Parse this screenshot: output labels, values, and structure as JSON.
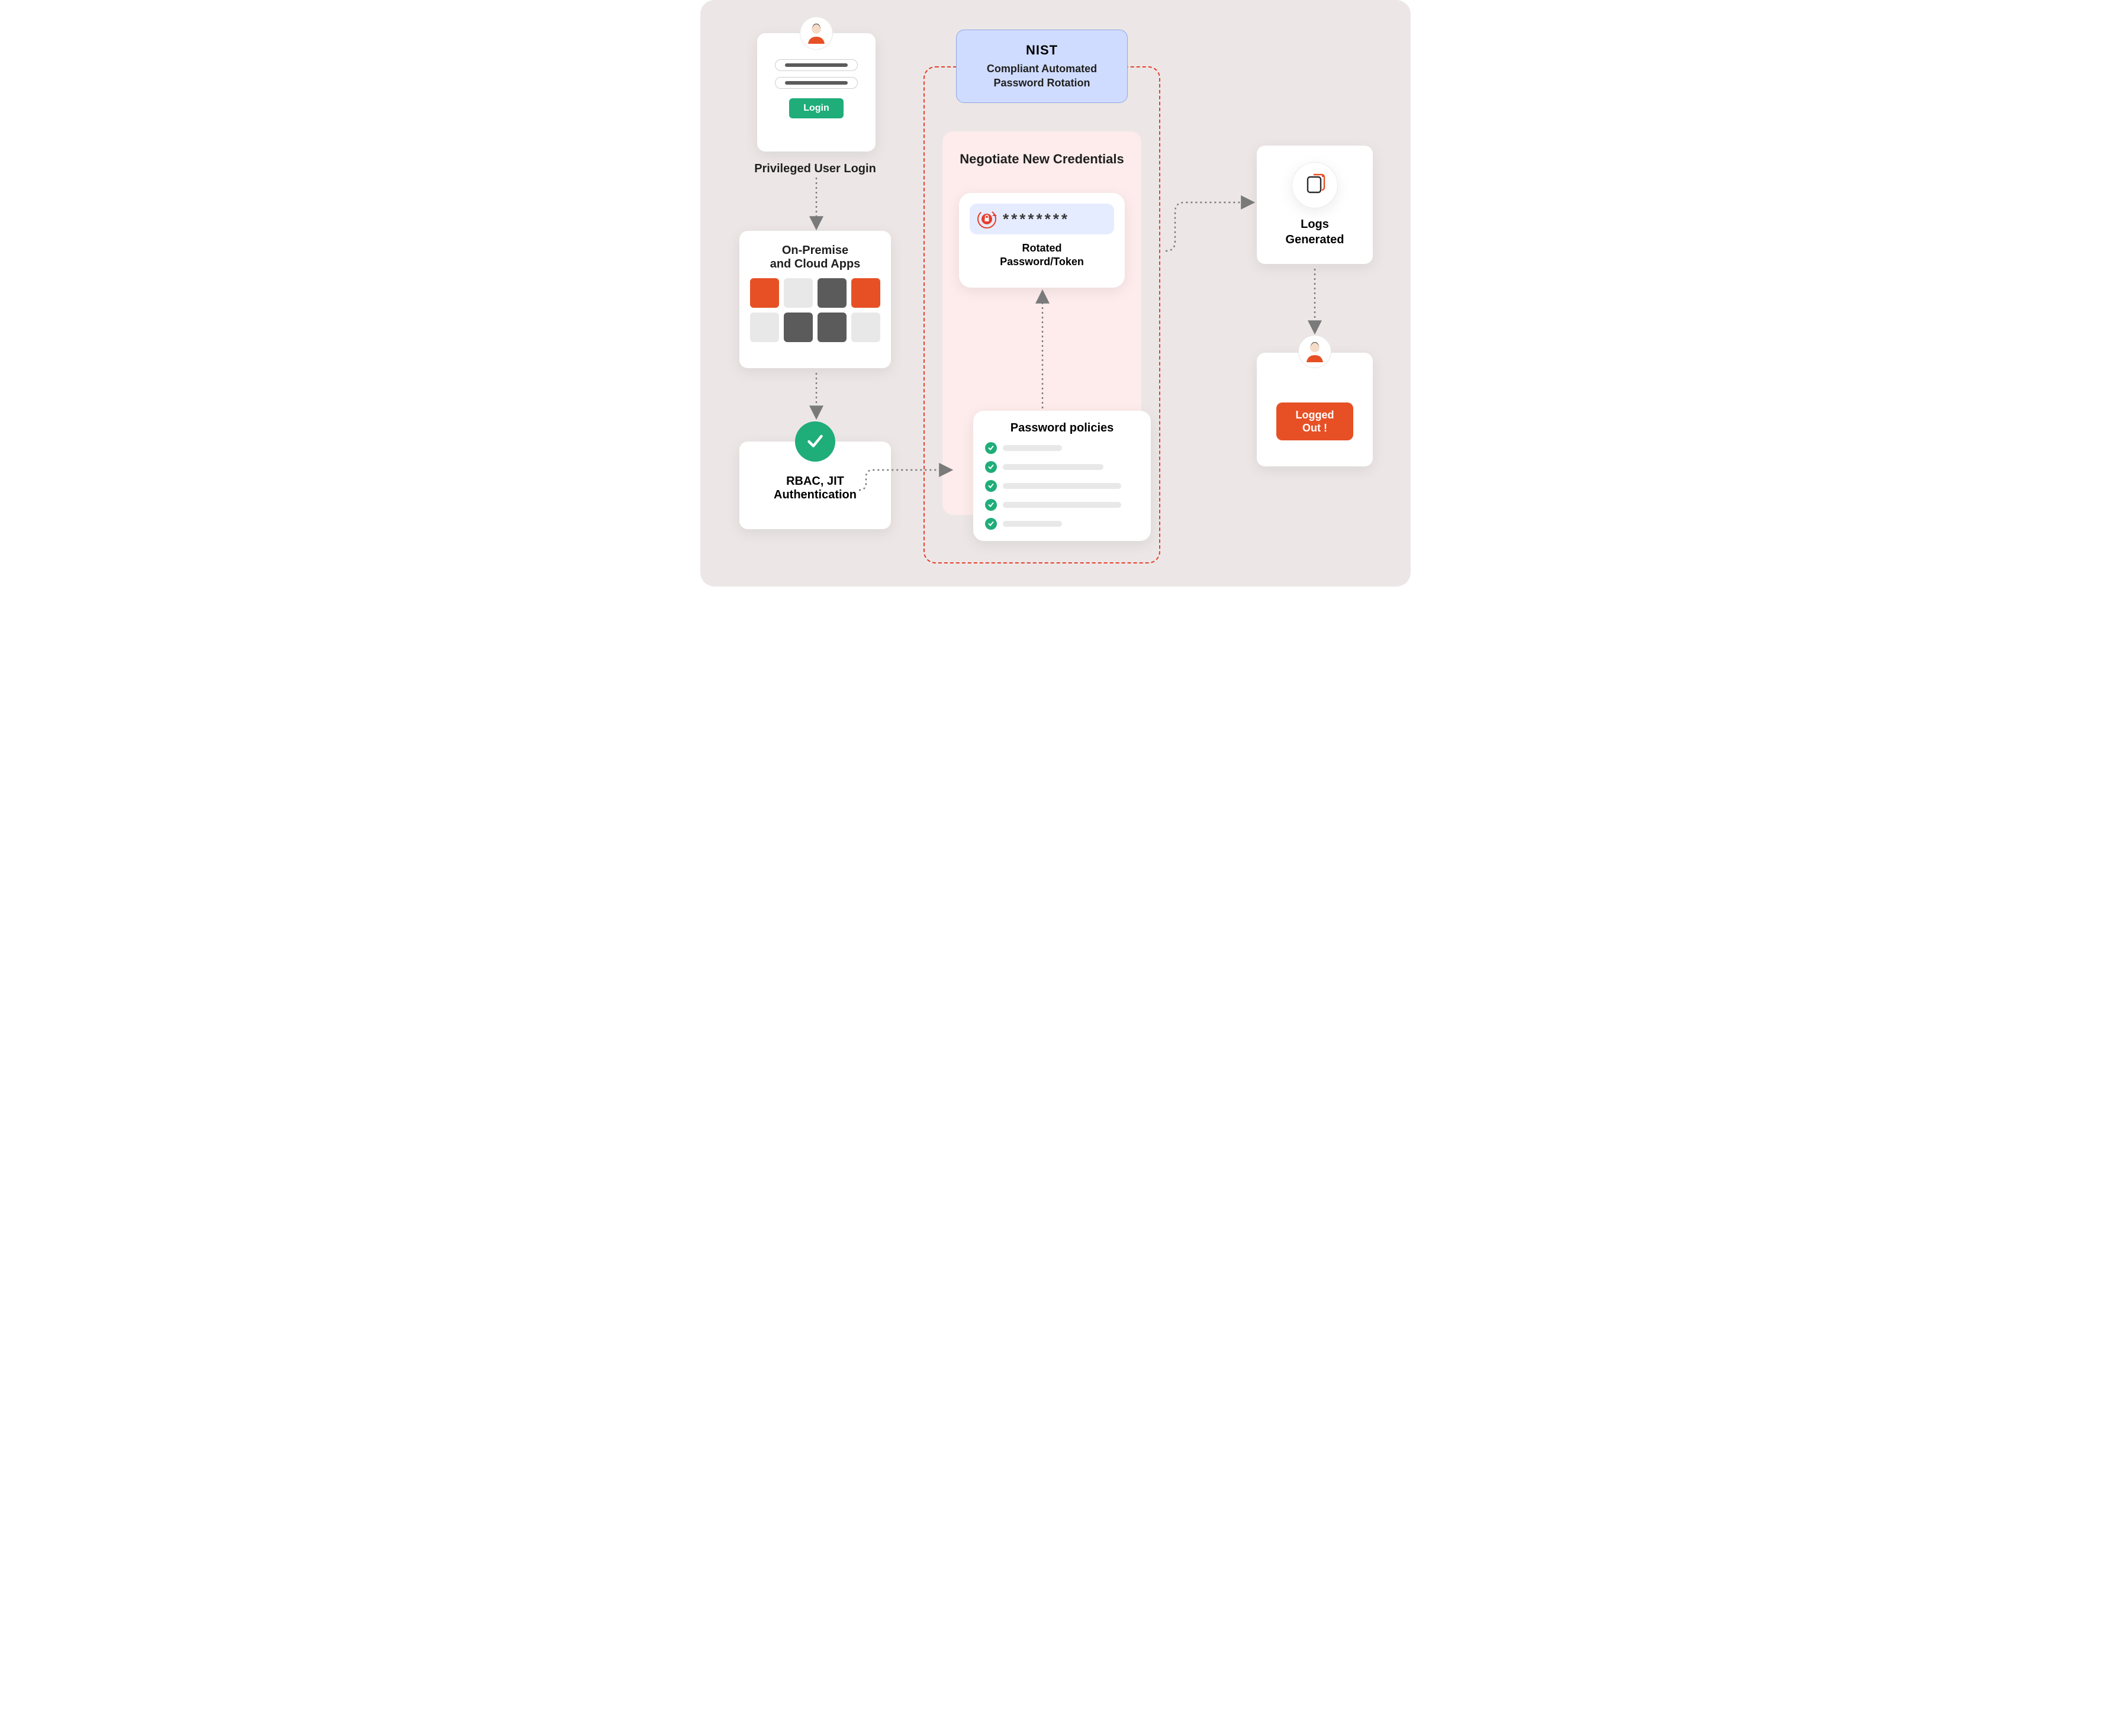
{
  "login": {
    "button": "Login",
    "caption": "Privileged User Login"
  },
  "apps": {
    "title": "On-Premise\nand Cloud Apps"
  },
  "rbac": {
    "title": "RBAC, JIT\nAuthentication"
  },
  "nist": {
    "logo": "NIST",
    "caption": "Compliant Automated\nPassword Rotation"
  },
  "negotiate": {
    "title": "Negotiate New Credentials"
  },
  "rotated": {
    "stars": "********",
    "caption": "Rotated\nPassword/Token"
  },
  "policies": {
    "title": "Password policies"
  },
  "logs": {
    "caption": "Logs\nGenerated"
  },
  "logout": {
    "button": "Logged\nOut !"
  }
}
